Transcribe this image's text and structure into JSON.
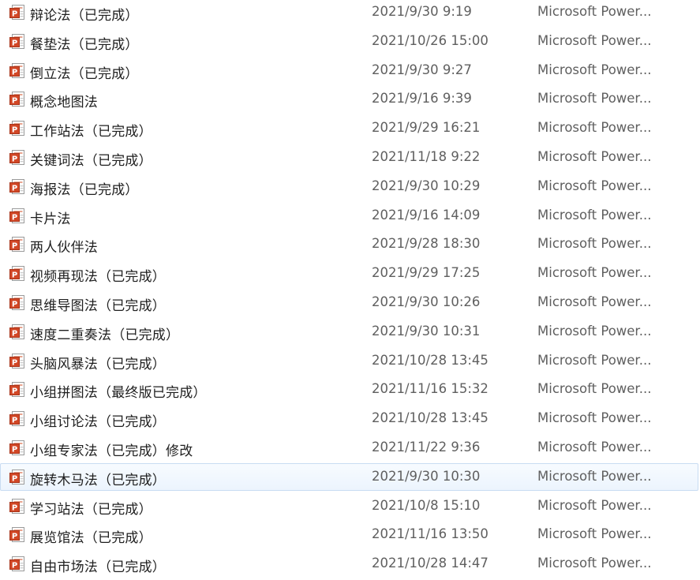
{
  "files": [
    {
      "name": "辩论法（已完成）",
      "date": "2021/9/30 9:19",
      "type": "Microsoft Power...",
      "icon": "powerpoint-file-icon"
    },
    {
      "name": "餐垫法（已完成）",
      "date": "2021/10/26 15:00",
      "type": "Microsoft Power...",
      "icon": "powerpoint-file-icon"
    },
    {
      "name": "倒立法（已完成）",
      "date": "2021/9/30 9:27",
      "type": "Microsoft Power...",
      "icon": "powerpoint-file-icon"
    },
    {
      "name": "概念地图法",
      "date": "2021/9/16 9:39",
      "type": "Microsoft Power...",
      "icon": "powerpoint-file-icon"
    },
    {
      "name": "工作站法（已完成）",
      "date": "2021/9/29 16:21",
      "type": "Microsoft Power...",
      "icon": "powerpoint-file-icon"
    },
    {
      "name": "关键词法（已完成）",
      "date": "2021/11/18 9:22",
      "type": "Microsoft Power...",
      "icon": "powerpoint-file-icon"
    },
    {
      "name": "海报法（已完成）",
      "date": "2021/9/30 10:29",
      "type": "Microsoft Power...",
      "icon": "powerpoint-file-icon"
    },
    {
      "name": "卡片法",
      "date": "2021/9/16 14:09",
      "type": "Microsoft Power...",
      "icon": "powerpoint-file-icon"
    },
    {
      "name": "两人伙伴法",
      "date": "2021/9/28 18:30",
      "type": "Microsoft Power...",
      "icon": "powerpoint-file-icon"
    },
    {
      "name": "视频再现法（已完成）",
      "date": "2021/9/29 17:25",
      "type": "Microsoft Power...",
      "icon": "powerpoint-file-icon"
    },
    {
      "name": "思维导图法（已完成）",
      "date": "2021/9/30 10:26",
      "type": "Microsoft Power...",
      "icon": "powerpoint-file-icon"
    },
    {
      "name": "速度二重奏法（已完成）",
      "date": "2021/9/30 10:31",
      "type": "Microsoft Power...",
      "icon": "powerpoint-file-icon"
    },
    {
      "name": "头脑风暴法（已完成）",
      "date": "2021/10/28 13:45",
      "type": "Microsoft Power...",
      "icon": "powerpoint-file-icon"
    },
    {
      "name": "小组拼图法（最终版已完成）",
      "date": "2021/11/16 15:32",
      "type": "Microsoft Power...",
      "icon": "powerpoint-file-icon"
    },
    {
      "name": "小组讨论法（已完成）",
      "date": "2021/10/28 13:45",
      "type": "Microsoft Power...",
      "icon": "powerpoint-file-icon"
    },
    {
      "name": "小组专家法（已完成）修改",
      "date": "2021/11/22 9:36",
      "type": "Microsoft Power...",
      "icon": "powerpoint-file-icon"
    },
    {
      "name": "旋转木马法（已完成）",
      "date": "2021/9/30 10:30",
      "type": "Microsoft Power...",
      "icon": "powerpoint-file-icon",
      "hovered": true
    },
    {
      "name": "学习站法（已完成）",
      "date": "2021/10/8 15:10",
      "type": "Microsoft Power...",
      "icon": "powerpoint-file-icon"
    },
    {
      "name": "展览馆法（已完成）",
      "date": "2021/11/16 13:50",
      "type": "Microsoft Power...",
      "icon": "powerpoint-file-icon"
    },
    {
      "name": "自由市场法（已完成）",
      "date": "2021/10/28 14:47",
      "type": "Microsoft Power...",
      "icon": "powerpoint-file-icon"
    }
  ],
  "colors": {
    "hover_background": "#ecf4fd",
    "hover_border": "#c8dcf2",
    "icon_orange": "#d24726"
  }
}
